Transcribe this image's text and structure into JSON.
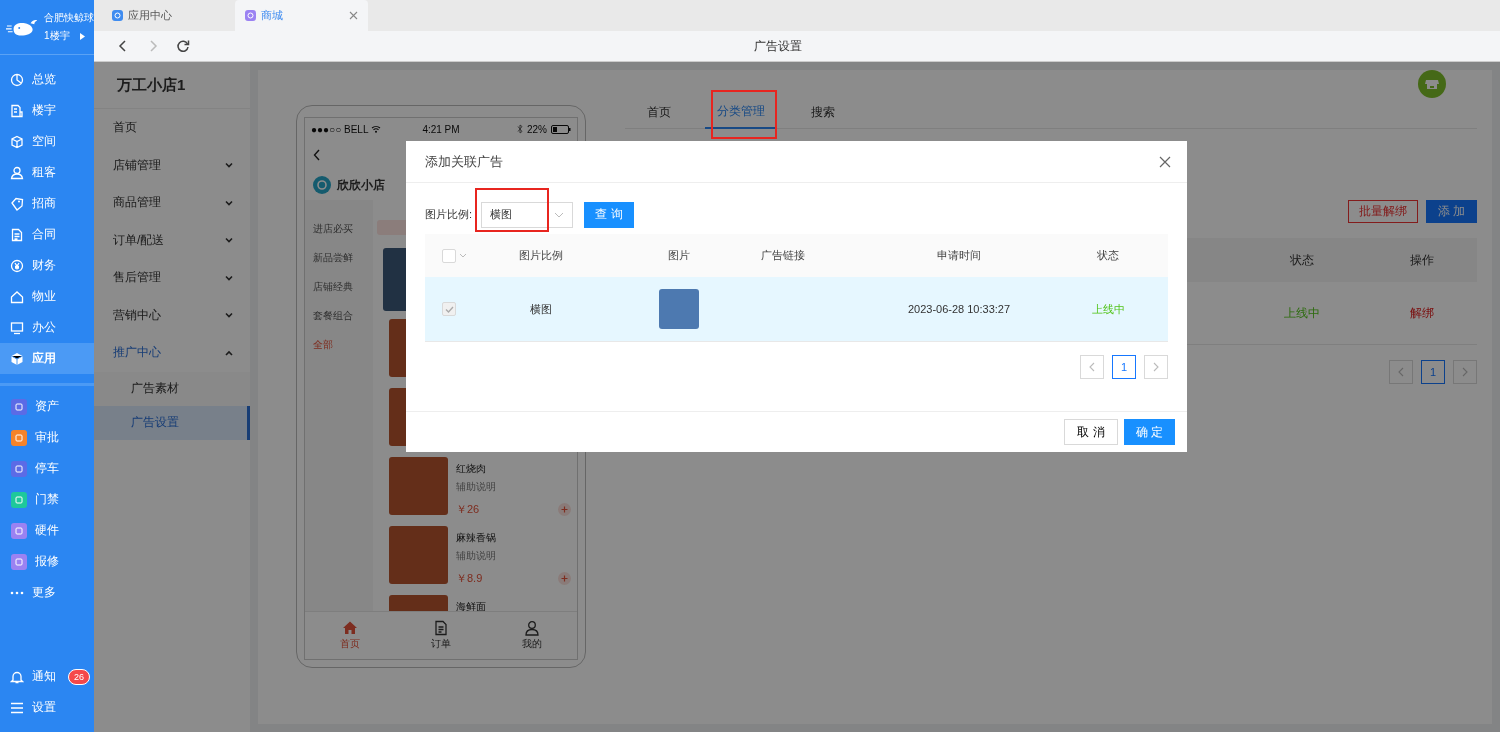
{
  "sidebar": {
    "org": "合肥快鲸球",
    "building": "1楼宇",
    "nav": [
      {
        "label": "总览",
        "selected": false
      },
      {
        "label": "楼宇",
        "selected": false
      },
      {
        "label": "空间",
        "selected": false
      },
      {
        "label": "租客",
        "selected": false
      },
      {
        "label": "招商",
        "selected": false
      },
      {
        "label": "合同",
        "selected": false
      },
      {
        "label": "财务",
        "selected": false
      },
      {
        "label": "物业",
        "selected": false
      },
      {
        "label": "办公",
        "selected": false
      },
      {
        "label": "应用",
        "selected": true
      }
    ],
    "apps": [
      {
        "label": "资产",
        "color": "#5b6be6"
      },
      {
        "label": "审批",
        "color": "#f5832a"
      },
      {
        "label": "停车",
        "color": "#5b6be6"
      },
      {
        "label": "门禁",
        "color": "#1ec89b"
      },
      {
        "label": "硬件",
        "color": "#9b82f2"
      },
      {
        "label": "报修",
        "color": "#9b82f2"
      }
    ],
    "more": "更多",
    "notifications": {
      "label": "通知",
      "count": "26"
    },
    "settings": "设置"
  },
  "browser_tabs": [
    {
      "label": "应用中心",
      "selected": false
    },
    {
      "label": "商城",
      "selected": true
    }
  ],
  "nav_bar": {
    "title": "广告设置",
    "forward_disabled": true
  },
  "store_menu": {
    "title": "万工小店1",
    "items": [
      {
        "label": "首页"
      },
      {
        "label": "店铺管理",
        "expanded": false
      },
      {
        "label": "商品管理",
        "expanded": false
      },
      {
        "label": "订单/配送",
        "expanded": false
      },
      {
        "label": "售后管理",
        "expanded": false
      },
      {
        "label": "营销中心",
        "expanded": false
      },
      {
        "label": "推广中心",
        "expanded": true,
        "children": [
          {
            "label": "广告素材",
            "selected": false
          },
          {
            "label": "广告设置",
            "selected": true
          }
        ]
      }
    ]
  },
  "phone": {
    "carrier": "●●●○○ BELL",
    "time": "4:21 PM",
    "battery": "22%",
    "shop_name": "欣欣小店",
    "categories": [
      {
        "label": "进店必买",
        "selected": false
      },
      {
        "label": "新品尝鲜",
        "selected": false
      },
      {
        "label": "店铺经典",
        "selected": false
      },
      {
        "label": "套餐组合",
        "selected": false
      },
      {
        "label": "全部",
        "selected": true
      }
    ],
    "products": [
      {
        "kind": "covered"
      },
      {
        "kind": "covered"
      },
      {
        "kind": "item",
        "name": "红烧肉",
        "subtitle": "辅助说明",
        "price": "￥26"
      },
      {
        "kind": "item",
        "name": "麻辣香锅",
        "subtitle": "辅助说明",
        "price": "￥8.9"
      },
      {
        "kind": "item",
        "name": "海鲜面"
      }
    ],
    "tab_bar": [
      {
        "label": "首页",
        "selected": true
      },
      {
        "label": "订单",
        "selected": false
      },
      {
        "label": "我的",
        "selected": false
      }
    ]
  },
  "page": {
    "tabs": [
      {
        "label": "首页",
        "selected": false,
        "highlighted": false
      },
      {
        "label": "分类管理",
        "selected": true,
        "highlighted": true
      },
      {
        "label": "搜索",
        "selected": false,
        "highlighted": false
      }
    ],
    "unbind_button": "批量解绑",
    "add_button": "添 加",
    "table": {
      "columns": [
        "状态",
        "操作"
      ],
      "rows": [
        {
          "status": "上线中",
          "action": "解绑"
        }
      ]
    },
    "pagination": [
      {
        "label": "1",
        "selected": true
      }
    ]
  },
  "modal": {
    "title": "添加关联广告",
    "filter": {
      "label": "图片比例:",
      "value": "横图",
      "highlighted": true
    },
    "query_button": "查 询",
    "table": {
      "header_checked": false,
      "columns": [
        "图片比例",
        "图片",
        "广告链接",
        "申请时间",
        "状态"
      ],
      "rows": [
        {
          "selected": true,
          "checked": true,
          "ratio": "横图",
          "time": "2023-06-28 10:33:27",
          "status": "上线中"
        }
      ]
    },
    "pagination": [
      {
        "label": "1",
        "selected": true
      }
    ],
    "cancel_button": "取 消",
    "ok_button": "确 定"
  }
}
